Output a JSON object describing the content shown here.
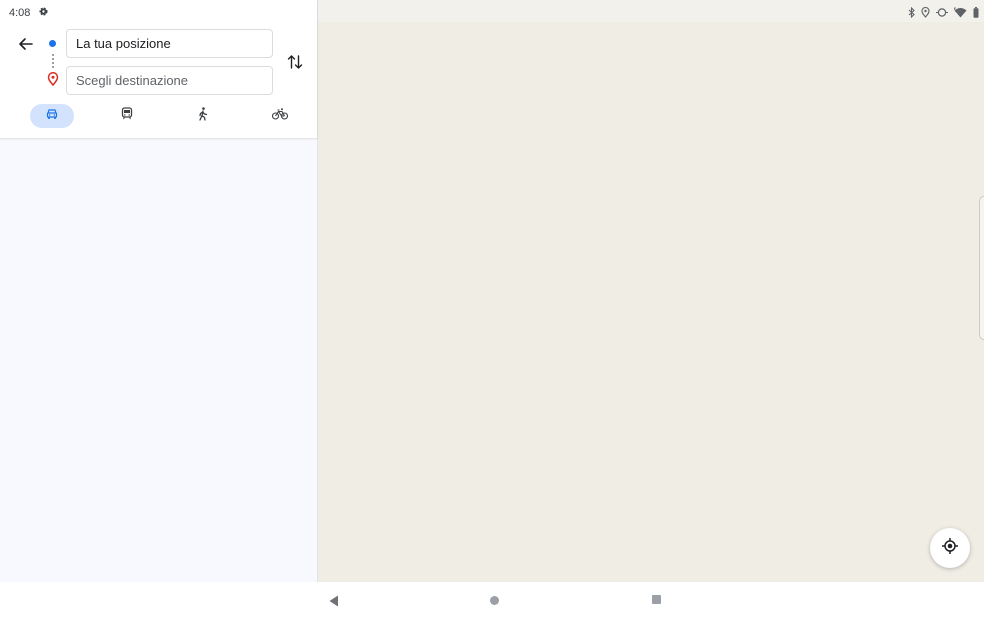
{
  "status_bar": {
    "time": "4:08",
    "icons": [
      "settings-gear-icon",
      "bluetooth-icon",
      "location-icon",
      "data-saver-icon",
      "wifi-icon",
      "battery-icon"
    ]
  },
  "directions": {
    "back_icon": "arrow-back-icon",
    "origin": {
      "value": "La tua posizione",
      "marker_icon": "origin-dot-icon"
    },
    "destination": {
      "placeholder": "Scegli destinazione",
      "marker_icon": "destination-pin-icon"
    },
    "swap_icon": "swap-vertical-icon",
    "travel_modes": [
      {
        "mode": "car",
        "icon": "car-icon",
        "selected": true
      },
      {
        "mode": "transit",
        "icon": "train-icon",
        "selected": false
      },
      {
        "mode": "walk",
        "icon": "walk-icon",
        "selected": false
      },
      {
        "mode": "bike",
        "icon": "bike-icon",
        "selected": false
      }
    ]
  },
  "map": {
    "locate_icon": "my-location-icon"
  },
  "system_nav": {
    "icons": [
      "nav-back-icon",
      "nav-home-icon",
      "nav-recents-icon"
    ]
  },
  "colors": {
    "accent_blue": "#1a73e8",
    "selected_mode_bg": "#d3e3fd",
    "pin_red": "#d93025",
    "map_bg": "#f0ede5",
    "panel_bg": "#f8f9fe"
  }
}
